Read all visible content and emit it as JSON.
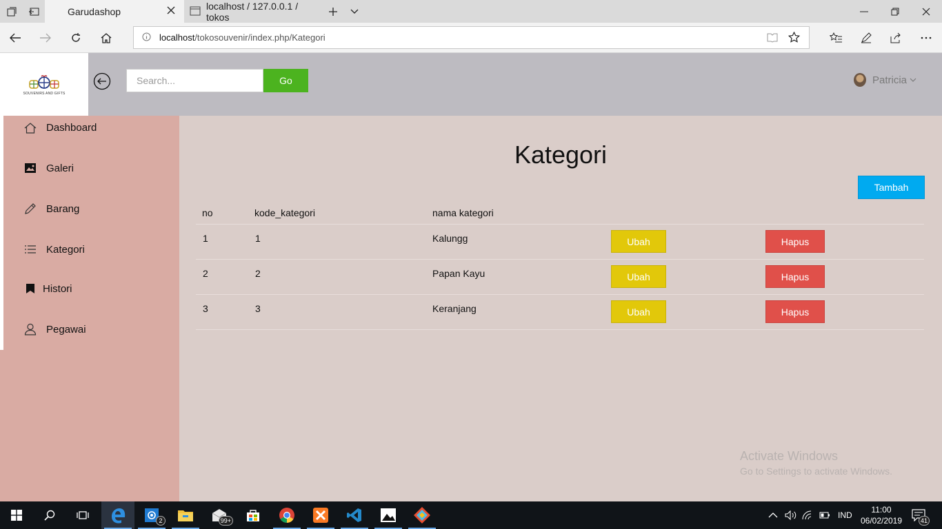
{
  "browser": {
    "tabs": [
      {
        "title": "Garudashop",
        "active": true
      },
      {
        "title": "localhost / 127.0.0.1 / tokos",
        "active": false
      }
    ],
    "url_host": "localhost",
    "url_path": "/tokosouvenir/index.php/Kategori"
  },
  "header": {
    "logo_text": "SOUVENIRS AND GIFTS",
    "search_placeholder": "Search...",
    "go_label": "Go",
    "user_name": "Patricia"
  },
  "sidebar": {
    "items": [
      {
        "label": "Dashboard",
        "icon": "home-icon"
      },
      {
        "label": "Galeri",
        "icon": "image-icon"
      },
      {
        "label": "Barang",
        "icon": "pencil-icon"
      },
      {
        "label": "Kategori",
        "icon": "list-icon"
      },
      {
        "label": "Histori",
        "icon": "bookmark-icon"
      },
      {
        "label": "Pegawai",
        "icon": "user-icon"
      }
    ]
  },
  "main": {
    "title": "Kategori",
    "add_label": "Tambah",
    "columns": [
      "no",
      "kode_kategori",
      "nama kategori"
    ],
    "rows": [
      {
        "no": "1",
        "kode": "1",
        "nama": "Kalungg",
        "edit": "Ubah",
        "delete": "Hapus"
      },
      {
        "no": "2",
        "kode": "2",
        "nama": "Papan Kayu",
        "edit": "Ubah",
        "delete": "Hapus"
      },
      {
        "no": "3",
        "kode": "3",
        "nama": "Keranjang",
        "edit": "Ubah",
        "delete": "Hapus"
      }
    ]
  },
  "watermark": {
    "line1": "Activate Windows",
    "line2": "Go to Settings to activate Windows."
  },
  "taskbar": {
    "badge_mail": "2",
    "badge_store": "99+",
    "lang": "IND",
    "time": "11:00",
    "date": "06/02/2019",
    "notifications": "41"
  },
  "colors": {
    "sidebar_bg": "#d9aba3",
    "main_bg": "#dacdc9",
    "header_bg": "#bdbbc1",
    "go_button": "#4cb31f",
    "add_button": "#00aaf0",
    "edit_button": "#e2c80a",
    "delete_button": "#e0504a"
  }
}
